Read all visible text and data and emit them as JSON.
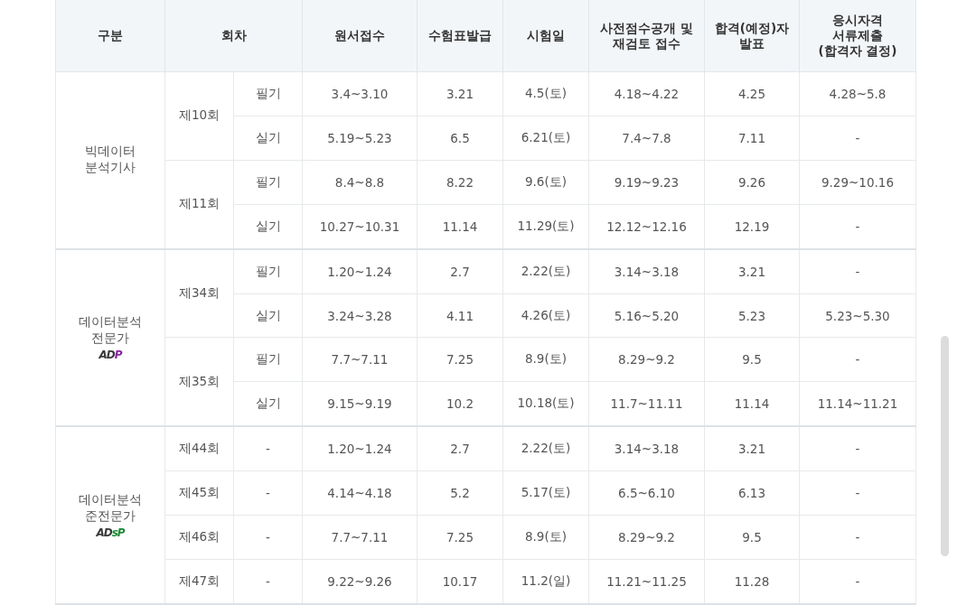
{
  "table": {
    "columns": [
      {
        "lines": [
          "구분"
        ]
      },
      {
        "lines": [
          "회차"
        ]
      },
      {
        "lines": [
          "원서접수"
        ]
      },
      {
        "lines": [
          "수험표발급"
        ]
      },
      {
        "lines": [
          "시험일"
        ]
      },
      {
        "lines": [
          "사전점수공개 및",
          "재검토 접수"
        ]
      },
      {
        "lines": [
          "합격(예정)자",
          "발표"
        ]
      },
      {
        "lines": [
          "응시자격",
          "서류제출",
          "(합격자 결정)"
        ]
      }
    ],
    "groups": [
      {
        "name": [
          "빅데이터",
          "분석기사"
        ],
        "rounds": [
          {
            "label": "제10회",
            "rows": [
              {
                "type": "필기",
                "cells": [
                  "3.4~3.10",
                  "3.21",
                  "4.5(토)",
                  "4.18~4.22",
                  "4.25",
                  "4.28~5.8"
                ]
              },
              {
                "type": "실기",
                "cells": [
                  "5.19~5.23",
                  "6.5",
                  "6.21(토)",
                  "7.4~7.8",
                  "7.11",
                  "-"
                ]
              }
            ]
          },
          {
            "label": "제11회",
            "rows": [
              {
                "type": "필기",
                "cells": [
                  "8.4~8.8",
                  "8.22",
                  "9.6(토)",
                  "9.19~9.23",
                  "9.26",
                  "9.29~10.16"
                ]
              },
              {
                "type": "실기",
                "cells": [
                  "10.27~10.31",
                  "11.14",
                  "11.29(토)",
                  "12.12~12.16",
                  "12.19",
                  "-"
                ]
              }
            ]
          }
        ]
      },
      {
        "name": [
          "데이터분석",
          "전문가"
        ],
        "logo": [
          {
            "text": "AD",
            "color": "#3a3a3a"
          },
          {
            "text": "P",
            "color": "#8b1fa9"
          }
        ],
        "rounds": [
          {
            "label": "제34회",
            "rows": [
              {
                "type": "필기",
                "cells": [
                  "1.20~1.24",
                  "2.7",
                  "2.22(토)",
                  "3.14~3.18",
                  "3.21",
                  "-"
                ]
              },
              {
                "type": "실기",
                "cells": [
                  "3.24~3.28",
                  "4.11",
                  "4.26(토)",
                  "5.16~5.20",
                  "5.23",
                  "5.23~5.30"
                ]
              }
            ]
          },
          {
            "label": "제35회",
            "rows": [
              {
                "type": "필기",
                "cells": [
                  "7.7~7.11",
                  "7.25",
                  "8.9(토)",
                  "8.29~9.2",
                  "9.5",
                  "-"
                ]
              },
              {
                "type": "실기",
                "cells": [
                  "9.15~9.19",
                  "10.2",
                  "10.18(토)",
                  "11.7~11.11",
                  "11.14",
                  "11.14~11.21"
                ]
              }
            ]
          }
        ]
      },
      {
        "name": [
          "데이터분석",
          "준전문가"
        ],
        "logo": [
          {
            "text": "AD",
            "color": "#3a3a3a"
          },
          {
            "text": "sP",
            "color": "#1f8a3a"
          }
        ],
        "rounds": [
          {
            "label": "제44회",
            "rows": [
              {
                "type": "-",
                "cells": [
                  "1.20~1.24",
                  "2.7",
                  "2.22(토)",
                  "3.14~3.18",
                  "3.21",
                  "-"
                ]
              }
            ]
          },
          {
            "label": "제45회",
            "rows": [
              {
                "type": "-",
                "cells": [
                  "4.14~4.18",
                  "5.2",
                  "5.17(토)",
                  "6.5~6.10",
                  "6.13",
                  "-"
                ]
              }
            ]
          },
          {
            "label": "제46회",
            "rows": [
              {
                "type": "-",
                "cells": [
                  "7.7~7.11",
                  "7.25",
                  "8.9(토)",
                  "8.29~9.2",
                  "9.5",
                  "-"
                ]
              }
            ]
          },
          {
            "label": "제47회",
            "rows": [
              {
                "type": "-",
                "cells": [
                  "9.22~9.26",
                  "10.17",
                  "11.2(일)",
                  "11.21~11.25",
                  "11.28",
                  "-"
                ]
              }
            ]
          }
        ]
      }
    ]
  }
}
